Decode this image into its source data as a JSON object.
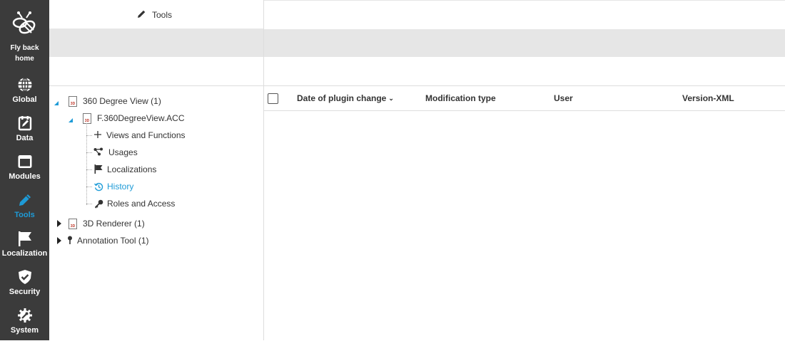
{
  "nav": {
    "home_label_1": "Fly back",
    "home_label_2": "home",
    "items": [
      {
        "label": "Global",
        "icon": "globe-icon"
      },
      {
        "label": "Data",
        "icon": "edit-box-icon"
      },
      {
        "label": "Modules",
        "icon": "window-icon"
      },
      {
        "label": "Tools",
        "icon": "pencil-icon",
        "active": true
      },
      {
        "label": "Localization",
        "icon": "flag-icon"
      },
      {
        "label": "Security",
        "icon": "shield-check-icon"
      },
      {
        "label": "System",
        "icon": "gear-wrench-icon"
      }
    ],
    "active_color": "#1e9bd7",
    "bg_color": "#3b3b3b"
  },
  "header": {
    "title": "Tools"
  },
  "tree": {
    "root1": "360 Degree View (1)",
    "child": "F.360DegreeView.ACC",
    "sub": [
      "Views and Functions",
      "Usages",
      "Localizations",
      "History",
      "Roles and Access"
    ],
    "active_sub": "History",
    "root2": "3D Renderer (1)",
    "root3": "Annotation Tool (1)"
  },
  "table": {
    "columns": [
      "Date of plugin change",
      "Modification type",
      "User",
      "Version-XML"
    ],
    "sorted_column": "Date of plugin change",
    "sort_direction": "descending"
  }
}
